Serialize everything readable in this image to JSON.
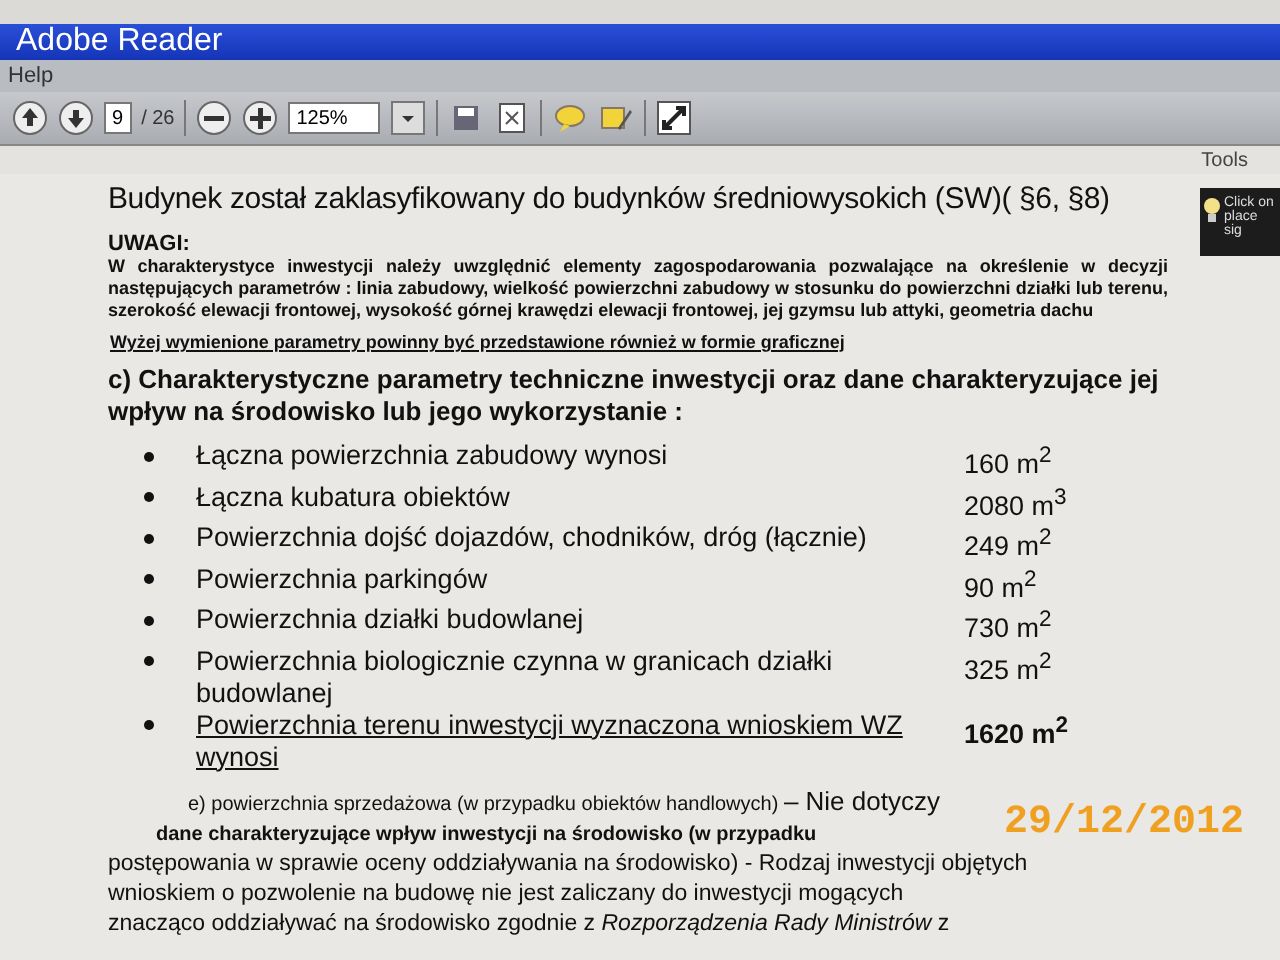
{
  "window": {
    "title": "Adobe Reader"
  },
  "menu": [
    "Help"
  ],
  "toolbar": {
    "page": "9",
    "page_total": "/ 26",
    "zoom": "125%",
    "tools": "Tools"
  },
  "tooltip": {
    "lines": [
      "Click on",
      "place sig"
    ]
  },
  "document": {
    "heading": "Budynek został zaklasyfikowany do budynków średniowysokich (SW)( §6, §8)",
    "note_title": "UWAGI:",
    "note_body": "W charakterystyce inwestycji należy uwzględnić elementy zagospodarowania pozwalające na określenie w decyzji następujących parametrów : linia zabudowy, wielkość powierzchni zabudowy w stosunku do powierzchni działki lub terenu, szerokość elewacji frontowej, wysokość górnej krawędzi elewacji frontowej, jej gzymsu lub attyki, geometria dachu",
    "note_link": "Wyżej wymienione  parametry powinny być przedstawione  również w formie graficznej",
    "section_c": "c) Charakterystyczne parametry techniczne inwestycji oraz dane charakteryzujące jej wpływ na środowisko lub jego wykorzystanie :",
    "items": [
      {
        "kind": "plain",
        "label": "Łączna powierzchnia zabudowy wynosi",
        "value": "160 m$^{2}$"
      },
      {
        "kind": "plain",
        "label": "Łączna kubatura obiektów",
        "value": "2080 m$^{3}$"
      },
      {
        "kind": "plain",
        "label": "Powierzchnia dojść dojazdów, chodników, dróg (łącznie)",
        "value": "249 m$^{2}$"
      },
      {
        "kind": "plain",
        "label": "Powierzchnia parkingów",
        "value": "90 m$^{2}$"
      },
      {
        "kind": "plain",
        "label": "Powierzchnia działki budowlanej",
        "value": "730 m$^{2}$"
      },
      {
        "kind": "plain",
        "label": "Powierzchnia biologicznie czynna w granicach działki budowlanej",
        "value": "325 m$^{2}$"
      },
      {
        "kind": "total",
        "label": "Powierzchnia terenu inwestycji wyznaczona wnioskiem WZ wynosi",
        "value": "1620 m$^{2}$"
      }
    ],
    "section_e": {
      "text": "e) powierzchnia sprzedażowa",
      "note": "(w przypadku obiektów handlowych)",
      "answer": "– Nie dotyczy"
    },
    "section_f": [
      "dane charakteryzujące wpływ inwestycji na środowisko (w przypadku",
      "postępowania w sprawie oceny oddziaływania na środowisko) - Rodzaj inwestycji objętych",
      "wnioskiem o pozwolenie na budowę nie jest zaliczany do inwestycji mogących",
      "znacząco oddziaływać na środowisko zgodnie z *Rozporządzenia Rady Ministrów* z"
    ]
  },
  "date_stamp": "29/12/2012"
}
